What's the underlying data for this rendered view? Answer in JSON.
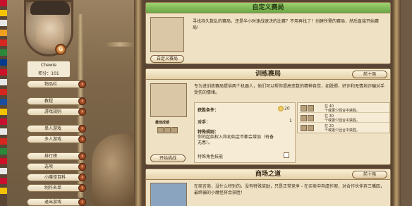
{
  "colors": {
    "accent_green": "#7cbf52",
    "parchment": "#efe2c4",
    "menu_knob": "#a0461f"
  },
  "user": {
    "name": "Chewie",
    "score_label": "积分：",
    "score_value": "101",
    "badge": "G"
  },
  "menu": {
    "items": [
      {
        "label": "物品栏",
        "icon": "chevron-right-icon"
      },
      {
        "label": "教程",
        "icon": "chevron-right-icon"
      },
      {
        "label": "游戏规则",
        "icon": "chevron-right-icon"
      },
      {
        "label": "单人游戏",
        "icon": "chevron-right-icon"
      },
      {
        "label": "多人游戏",
        "icon": "chevron-right-icon"
      },
      {
        "label": "排行榜",
        "icon": "chevron-right-icon"
      },
      {
        "label": "选项",
        "icon": "chevron-right-icon"
      },
      {
        "label": "小魔怪百科",
        "icon": "chevron-right-icon"
      },
      {
        "label": "制作名单",
        "icon": "chevron-right-icon"
      },
      {
        "label": "退出游戏",
        "icon": "chevron-right-icon"
      }
    ]
  },
  "custom_match": {
    "title": "自定义赛局",
    "description": "寻找持久数乱的赛局，还是半小时速战速决的比赛？不用再找了！创建所需的赛局，然后直接开始赛局！",
    "button": "自定义赛局"
  },
  "training_match": {
    "title": "训练赛局",
    "top_button": "前十强",
    "description": "专为进训练赛局提供两个机器人，他们可以帮你提高变数的精神自觉，如脱掷、奸诈和无情地诈骗对手受伤的情绪。",
    "best_score_label": "最佳成绩",
    "start_button": "开始挑战",
    "rules": {
      "condition_label": "获胜条件：",
      "condition_value": "20",
      "opponent_label": "对手：",
      "opponent_value": "1",
      "special_label": "特殊规则：",
      "special_value": "你的起始权入和初始金币都会增加（有备无患）。",
      "character_label": "特殊角色技能"
    },
    "rewards": [
      {
        "line1": "在 40",
        "line2": "个或更少回合中获胜。"
      },
      {
        "line1": "在 30",
        "line2": "个或更少回合中获胜。"
      },
      {
        "line1": "在 20",
        "line2": "个或更少回合中获胜。"
      }
    ]
  },
  "mall_match": {
    "title": "商场之道",
    "top_button": "前十强",
    "description": "在商言商，没什么特别的。没有特殊奖励，只是正常竞争 - 在买卖中弃虐作假，对合作伙伴弃三嘴四，最终骗的小魔怪将会获胜！"
  }
}
